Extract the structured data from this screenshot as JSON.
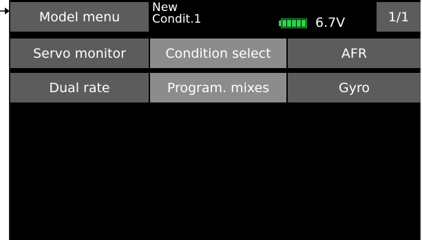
{
  "header": {
    "model_menu_label": "Model menu",
    "condition_line1": "New",
    "condition_line2": "Condit.1",
    "battery_icon": "battery-icon",
    "voltage": "6.7V",
    "page_indicator": "1/1"
  },
  "menu": {
    "rows": [
      [
        "Servo monitor",
        "Condition select",
        "AFR"
      ],
      [
        "Dual rate",
        "Program. mixes",
        "Gyro"
      ]
    ]
  },
  "colors": {
    "screen_bg": "#000000",
    "button_bg": "#5c5c5c",
    "button_highlight_bg": "#8c8c8c",
    "battery": "#2fd14a",
    "text": "#ffffff"
  }
}
